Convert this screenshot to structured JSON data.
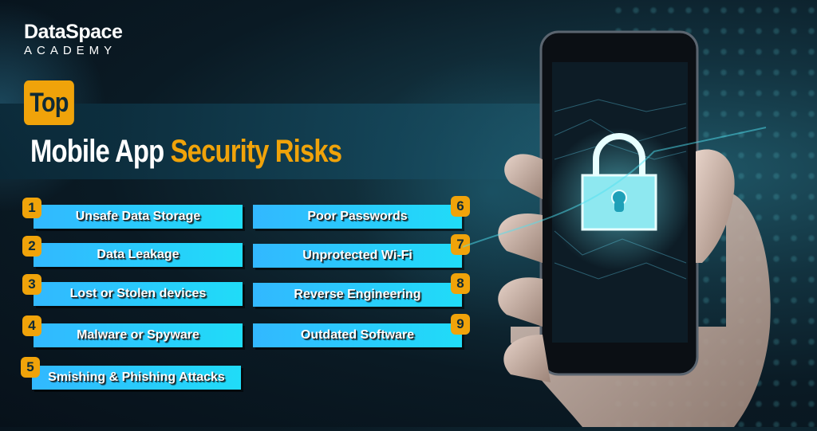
{
  "brand": {
    "name": "DataSpace",
    "subtitle": "ACADEMY"
  },
  "heading": {
    "badge": "Top",
    "title_white": "Mobile App",
    "title_yellow": "Security Risks"
  },
  "colors": {
    "accent_yellow": "#f0a30a",
    "item_cyan": "#20dcf8",
    "item_blue": "#32b8ff",
    "background": "#0a1a24"
  },
  "risks_left": [
    {
      "number": "1",
      "label": "Unsafe Data Storage"
    },
    {
      "number": "2",
      "label": "Data Leakage"
    },
    {
      "number": "3",
      "label": "Lost or Stolen devices"
    },
    {
      "number": "4",
      "label": "Malware or Spyware"
    },
    {
      "number": "5",
      "label": "Smishing & Phishing Attacks"
    }
  ],
  "risks_right": [
    {
      "number": "6",
      "label": "Poor Passwords"
    },
    {
      "number": "7",
      "label": "Unprotected Wi-Fi"
    },
    {
      "number": "8",
      "label": "Reverse Engineering"
    },
    {
      "number": "9",
      "label": "Outdated Software"
    }
  ],
  "illustration": {
    "icon": "padlock-icon",
    "subject": "hand holding smartphone"
  }
}
